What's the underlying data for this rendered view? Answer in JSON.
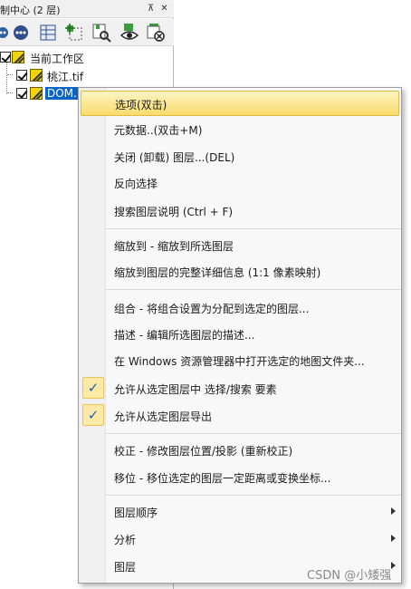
{
  "panel": {
    "title": "制中心 (2 层)",
    "pin_glyph": "⊼",
    "close_glyph": "✕"
  },
  "toolbar": {
    "buttons": [
      "options-icon",
      "table-icon",
      "select-icon",
      "zoom-layer-icon",
      "visibility-icon",
      "remove-layer-icon",
      "add-layer-icon"
    ]
  },
  "tree": {
    "workspace_label": "当前工作区",
    "layers": [
      {
        "label": "桃江.tif",
        "checked": true,
        "selected": false
      },
      {
        "label": "DOM...",
        "checked": true,
        "selected": true
      }
    ]
  },
  "menu": {
    "items": [
      {
        "label": "选项(双击)"
      },
      {
        "label": "元数据..(双击+M)"
      },
      {
        "label": "关闭 (卸载) 图层...(DEL)"
      },
      {
        "label": "反向选择"
      },
      {
        "label": "搜索图层说明 (Ctrl + F)"
      },
      {
        "label": "缩放到 - 缩放到所选图层"
      },
      {
        "label": "缩放到图层的完整详细信息 (1:1 像素映射)"
      },
      {
        "label": "组合 - 将组合设置为分配到选定的图层..."
      },
      {
        "label": "描述 - 编辑所选图层的描述..."
      },
      {
        "label": "在 Windows 资源管理器中打开选定的地图文件夹..."
      },
      {
        "label": "允许从选定图层中 选择/搜索 要素",
        "checked": true
      },
      {
        "label": "允许从选定图层导出",
        "checked": true
      },
      {
        "label": "校正 - 修改图层位置/投影 (重新校正)"
      },
      {
        "label": "移位 - 移位选定的图层一定距离或变换坐标..."
      },
      {
        "label": "图层顺序",
        "submenu": true
      },
      {
        "label": "分析",
        "submenu": true
      },
      {
        "label": "图层",
        "submenu": true
      }
    ],
    "check_glyph": "✓"
  },
  "watermark": "CSDN @小矮强"
}
